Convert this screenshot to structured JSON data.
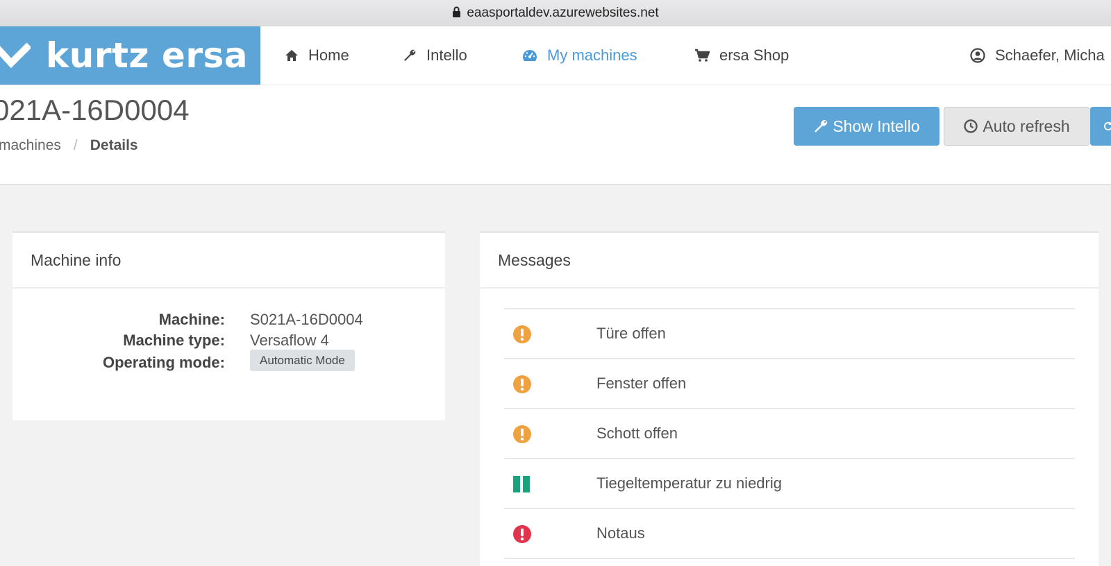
{
  "browser": {
    "url": "eaasportaldev.azurewebsites.net"
  },
  "brand": {
    "name": "kurtz ersa",
    "color": "#5da5d6"
  },
  "nav": {
    "items": [
      {
        "label": "Home",
        "icon": "home-icon"
      },
      {
        "label": "Intello",
        "icon": "wrench-icon"
      },
      {
        "label": "My machines",
        "icon": "dashboard-icon",
        "active": true
      },
      {
        "label": "ersa Shop",
        "icon": "cart-icon"
      }
    ],
    "user": {
      "label": "Schaefer, Micha",
      "icon": "user-circle-icon"
    }
  },
  "header": {
    "title": "021A-16D0004",
    "breadcrumb": {
      "parent": "machines",
      "separator": "/",
      "current": "Details"
    },
    "buttons": {
      "show_intello": "Show Intello",
      "auto_refresh": "Auto refresh"
    }
  },
  "machine_info": {
    "title": "Machine info",
    "rows": [
      {
        "label": "Machine:",
        "value": "S021A-16D0004"
      },
      {
        "label": "Machine type:",
        "value": "Versaflow 4"
      },
      {
        "label": "Operating mode:",
        "value": "Automatic Mode"
      }
    ]
  },
  "messages": {
    "title": "Messages",
    "items": [
      {
        "text": "Türe offen",
        "status": "warning",
        "color": "#f0a140"
      },
      {
        "text": "Fenster offen",
        "status": "warning",
        "color": "#f0a140"
      },
      {
        "text": "Schott offen",
        "status": "warning",
        "color": "#f0a140"
      },
      {
        "text": "Tiegeltemperatur zu niedrig",
        "status": "paused",
        "color": "#1aa37a"
      },
      {
        "text": "Notaus",
        "status": "error",
        "color": "#e0344d"
      }
    ]
  }
}
